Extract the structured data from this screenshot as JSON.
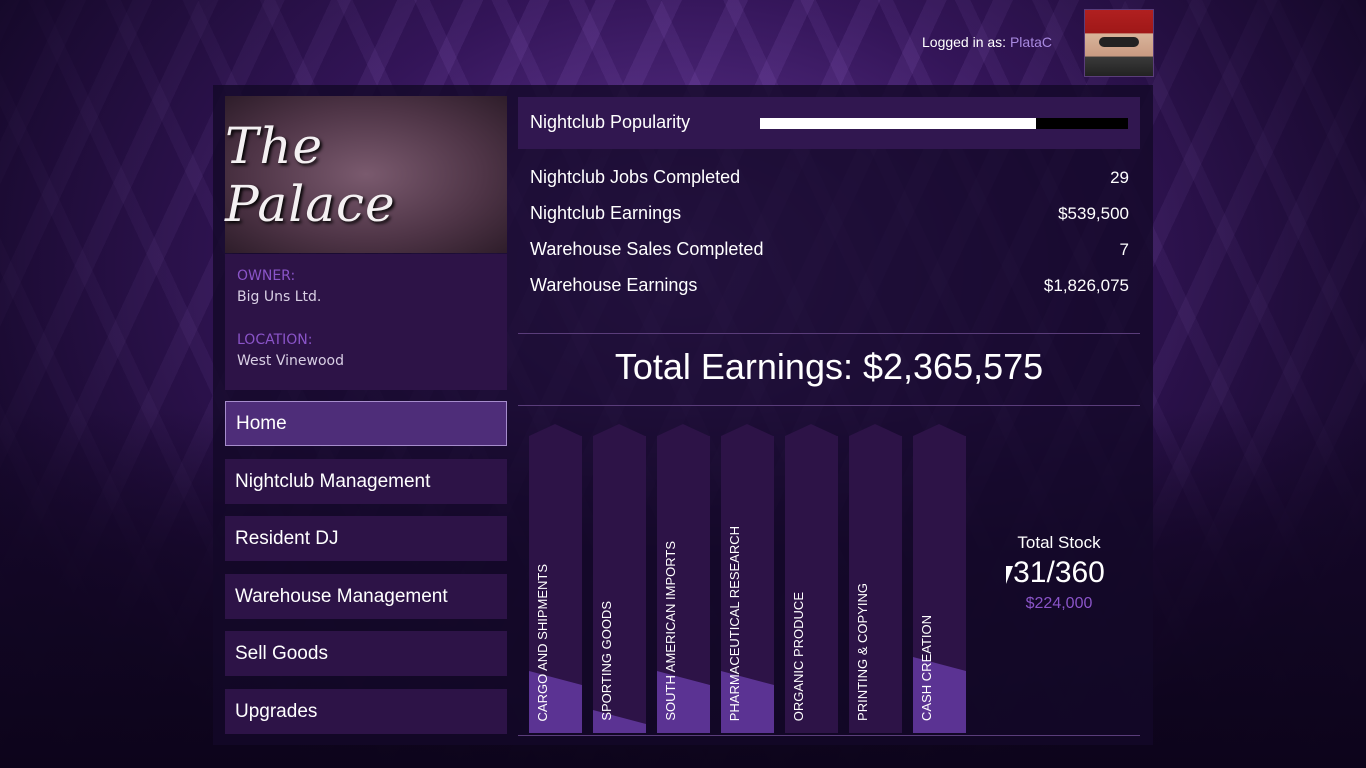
{
  "header": {
    "logged_in_label": "Logged in as:",
    "username": "PlataC"
  },
  "club": {
    "logo_text": "The Palace",
    "owner_label": "OWNER:",
    "owner": "Big Uns Ltd.",
    "location_label": "LOCATION:",
    "location": "West Vinewood"
  },
  "nav": [
    {
      "label": "Home",
      "active": true
    },
    {
      "label": "Nightclub Management"
    },
    {
      "label": "Resident DJ"
    },
    {
      "label": "Warehouse Management"
    },
    {
      "label": "Sell Goods"
    },
    {
      "label": "Upgrades"
    }
  ],
  "popularity": {
    "label": "Nightclub Popularity",
    "fraction": 0.75
  },
  "stats": [
    {
      "label": "Nightclub Jobs Completed",
      "value": "29"
    },
    {
      "label": "Nightclub Earnings",
      "value": "$539,500"
    },
    {
      "label": "Warehouse Sales Completed",
      "value": "7"
    },
    {
      "label": "Warehouse Earnings",
      "value": "$1,826,075"
    }
  ],
  "total_earnings": "Total Earnings: $2,365,575",
  "goods": [
    {
      "label": "CARGO AND SHIPMENTS",
      "fill": 0.16
    },
    {
      "label": "SPORTING GOODS",
      "fill": 0.03
    },
    {
      "label": "SOUTH AMERICAN IMPORTS",
      "fill": 0.16
    },
    {
      "label": "PHARMACEUTICAL RESEARCH",
      "fill": 0.16
    },
    {
      "label": "ORGANIC PRODUCE",
      "fill": 0.0
    },
    {
      "label": "PRINTING & COPYING",
      "fill": 0.0
    },
    {
      "label": "CASH CREATION",
      "fill": 0.21
    }
  ],
  "stock": {
    "title": "Total Stock",
    "count": "31/360",
    "value": "$224,000"
  },
  "colors": {
    "accent": "#8a54c8",
    "panel": "#2d1347",
    "active": "#4e2d79"
  }
}
